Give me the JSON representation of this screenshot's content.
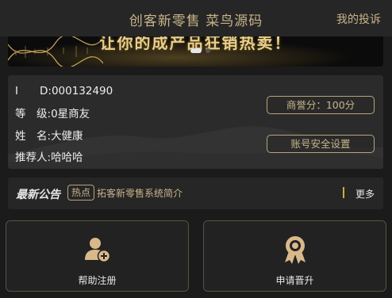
{
  "header": {
    "title": "创客新零售 菜鸟源码",
    "complaint_link": "我的投诉"
  },
  "banner": {
    "slogan": "让你的成产品狂销热卖！",
    "slide_count": 2,
    "active_slide": 1
  },
  "profile": {
    "id_label": "I　　D:",
    "id_value": "000132490",
    "level_label": "等　级:",
    "level_value": "0星商友",
    "name_label": "姓　名:",
    "name_value": "大健康",
    "referrer_label": "推荐人:",
    "referrer_value": "哈哈哈",
    "reputation_button": "商誉分：100分",
    "security_button": "账号安全设置"
  },
  "notice": {
    "heading": "最新公告",
    "badge": "热点",
    "text": "拓客新零售系统简介",
    "more": "更多"
  },
  "actions": {
    "register_label": "帮助注册",
    "promote_label": "申请晋升"
  },
  "colors": {
    "accent_gold": "#c9b48a",
    "icon_gold": "#d9b98a",
    "background": "#1b1b1b",
    "panel": "#2b2b2b"
  },
  "icons": {
    "register": "add-user-icon",
    "promote": "award-ribbon-icon"
  }
}
